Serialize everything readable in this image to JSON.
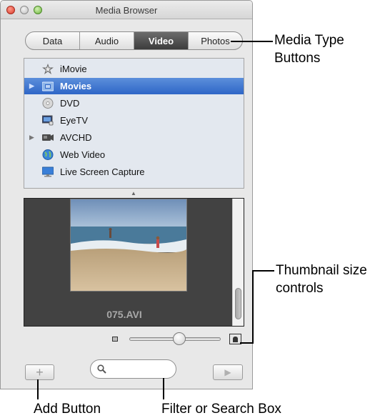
{
  "window": {
    "title": "Media Browser"
  },
  "media_type_buttons": [
    {
      "label": "Data",
      "active": false
    },
    {
      "label": "Audio",
      "active": false
    },
    {
      "label": "Video",
      "active": true
    },
    {
      "label": "Photos",
      "active": false
    }
  ],
  "sources": [
    {
      "label": "iMovie",
      "icon": "imovie-star-icon",
      "disclosure": false,
      "selected": false
    },
    {
      "label": "Movies",
      "icon": "movies-folder-icon",
      "disclosure": true,
      "selected": true
    },
    {
      "label": "DVD",
      "icon": "dvd-disc-icon",
      "disclosure": false,
      "selected": false
    },
    {
      "label": "EyeTV",
      "icon": "eyetv-icon",
      "disclosure": false,
      "selected": false
    },
    {
      "label": "AVCHD",
      "icon": "avchd-camera-icon",
      "disclosure": true,
      "selected": false
    },
    {
      "label": "Web Video",
      "icon": "globe-icon",
      "disclosure": false,
      "selected": false
    },
    {
      "label": "Live Screen Capture",
      "icon": "monitor-icon",
      "disclosure": false,
      "selected": false
    }
  ],
  "preview": {
    "caption": "075.AVI",
    "scroll_position": 0.75
  },
  "thumbnail_size": {
    "value": 0.55
  },
  "search": {
    "placeholder": "",
    "value": ""
  },
  "callouts": {
    "media_type": "Media Type Buttons",
    "thumbnail_size": "Thumbnail size controls",
    "add_button": "Add Button",
    "search_box": "Filter or Search Box"
  },
  "colors": {
    "selection": "#2e66c7",
    "active_segment": "#4a4a4a",
    "preview_background": "#424242"
  }
}
